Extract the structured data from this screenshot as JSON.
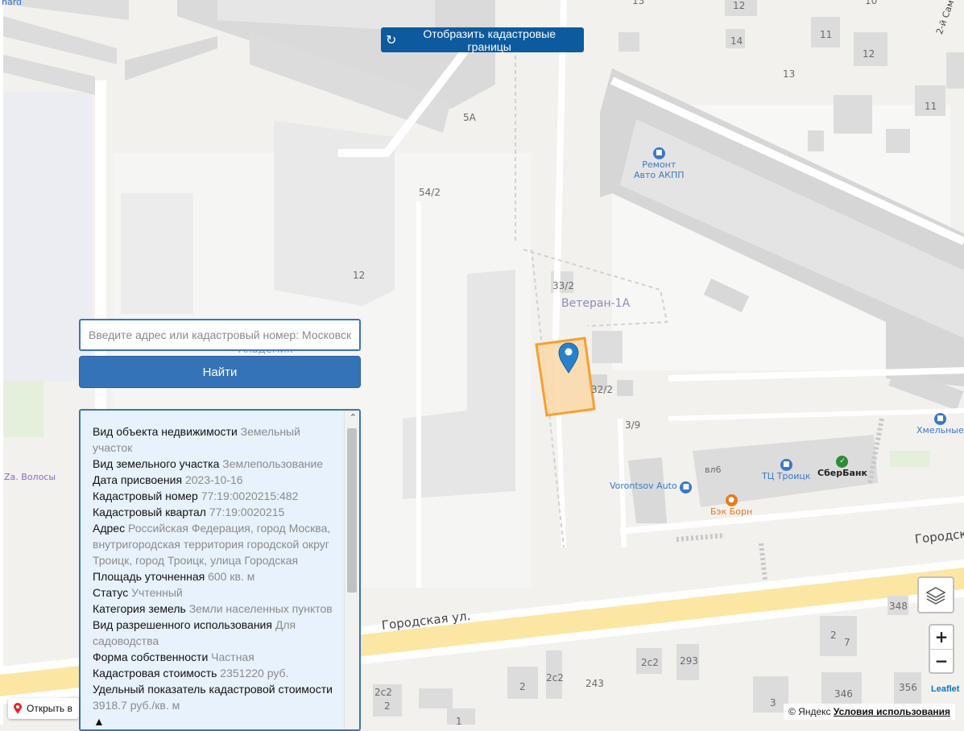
{
  "map": {
    "street_labels": [
      "Городская ул.",
      "Городск",
      "2-й Сам",
      "Za. Волосы",
      "hard"
    ],
    "house_numbers": [
      "13",
      "12",
      "14",
      "11",
      "10",
      "12",
      "13",
      "11",
      "5А",
      "54/2",
      "12",
      "33/2",
      "32/2",
      "3/9",
      "вл6",
      "348",
      "2",
      "7",
      "2с2",
      "293",
      "2с2",
      "2",
      "243",
      "2с2",
      "2",
      "3",
      "346",
      "356",
      "1"
    ],
    "place_label": "Ветеран-1А",
    "district_label": "Академик",
    "pois": [
      {
        "name": "Ремонт\nАвто АКПП",
        "icon": "car-service-icon",
        "color": "#3d78c6"
      },
      {
        "name": "ТЦ Троицк",
        "icon": "shopping-icon",
        "color": "#3d78c6"
      },
      {
        "name": "СберБанк",
        "icon": "sber-logo-icon",
        "color": "#2e8b3a"
      },
      {
        "name": "Vorontsov Auto",
        "icon": "car-service-icon",
        "color": "#3d78c6"
      },
      {
        "name": "Бэк Борн",
        "icon": "cafe-icon",
        "color": "#e67a1e"
      },
      {
        "name": "Хмельные",
        "icon": "shopping-icon",
        "color": "#3d78c6"
      }
    ],
    "parcel_highlight_color": "#f5a030"
  },
  "cadastral_button": {
    "label": "Отобразить кадастровые границы",
    "icon": "refresh-icon"
  },
  "search": {
    "placeholder": "Введите адрес или кадастровый номер: Московская",
    "button_label": "Найти"
  },
  "info": [
    {
      "k": "Вид объекта недвижимости",
      "v": "Земельный участок"
    },
    {
      "k": "Вид земельного участка",
      "v": "Землепользование"
    },
    {
      "k": "Дата присвоения",
      "v": "2023-10-16"
    },
    {
      "k": "Кадастровый номер",
      "v": "77:19:0020215:482"
    },
    {
      "k": "Кадастровый квартал",
      "v": "77:19:0020215"
    },
    {
      "k": "Адрес",
      "v": "Российская Федерация, город Москва, внутригородская территория городской округ Троицк, город Троицк, улица Городская"
    },
    {
      "k": "Площадь уточненная",
      "v": "600 кв. м"
    },
    {
      "k": "Статус",
      "v": "Учтенный"
    },
    {
      "k": "Категория земель",
      "v": "Земли населенных пунктов"
    },
    {
      "k": "Вид разрешенного использования",
      "v": "Для садоводства"
    },
    {
      "k": "Форма собственности",
      "v": "Частная"
    },
    {
      "k": "Кадастровая стоимость",
      "v": "2351220 руб."
    },
    {
      "k": "Удельный показатель кадастровой стоимости",
      "v": "3918.7 руб./кв. м"
    }
  ],
  "controls": {
    "zoom_in": "+",
    "zoom_out": "−",
    "leaflet": "Leaflet"
  },
  "attribution": {
    "text": "© Яндекс",
    "terms": "Условия использования"
  },
  "open_in": {
    "label": "Открыть в"
  }
}
